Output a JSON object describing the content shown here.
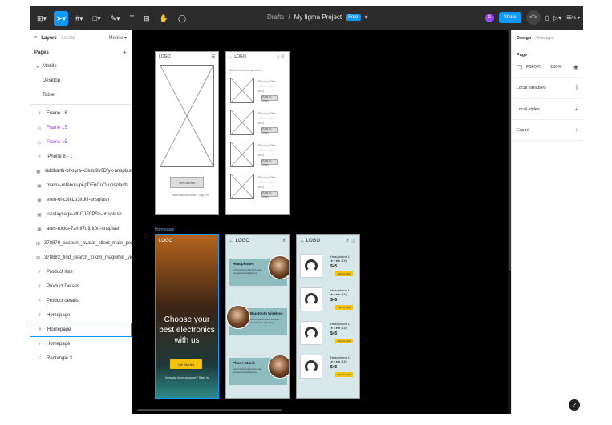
{
  "toolbar": {
    "tools": [
      {
        "icon": "figma-menu-icon",
        "label": "⊞▾",
        "active": false
      },
      {
        "icon": "move-tool-icon",
        "label": "➤▾",
        "active": true
      },
      {
        "icon": "frame-tool-icon",
        "label": "#▾",
        "active": false
      },
      {
        "icon": "shape-tool-icon",
        "label": "□▾",
        "active": false
      },
      {
        "icon": "pen-tool-icon",
        "label": "✎▾",
        "active": false
      },
      {
        "icon": "text-tool-icon",
        "label": "T",
        "active": false
      },
      {
        "icon": "resources-icon",
        "label": "⊞",
        "active": false
      },
      {
        "icon": "hand-tool-icon",
        "label": "✋",
        "active": false
      },
      {
        "icon": "comment-tool-icon",
        "label": "◯",
        "active": false
      }
    ],
    "breadcrumb_drafts": "Drafts",
    "breadcrumb_sep": "/",
    "project_name": "My figma Project",
    "plan_badge": "Free",
    "project_chevron": "▾",
    "avatar_letter": "A",
    "share_label": "Share",
    "dev_label": "</>",
    "library_icon": "▯",
    "present_icon": "▷▾",
    "zoom_label": "55% ▾"
  },
  "left_panel": {
    "tab_layers": "Layers",
    "tab_assets": "Assets",
    "page_dropdown": "Mobile ▾",
    "pages_heading": "Pages",
    "add_page": "+",
    "pages": [
      {
        "label": "Mobile",
        "checked": true
      },
      {
        "label": "Desktop",
        "checked": false
      },
      {
        "label": "Tablet",
        "checked": false
      }
    ],
    "layers": [
      {
        "label": "Frame 18",
        "icon": "#",
        "style": ""
      },
      {
        "label": "Frame 15",
        "icon": "◇",
        "style": "purple"
      },
      {
        "label": "Frame 15",
        "icon": "◇",
        "style": "purple"
      },
      {
        "label": "iPhone 8 - 1",
        "icon": "#",
        "style": ""
      },
      {
        "label": "siddharth-bhogra-k3kdu9k0Dfyk-unsplash 1",
        "icon": "▣",
        "style": ""
      },
      {
        "label": "mama-mfenou-pi-pDEnCoO-unsplash",
        "icon": "▣",
        "style": ""
      },
      {
        "label": "eren-ol-c3IcLo3xdU-unsplash",
        "icon": "▣",
        "style": ""
      },
      {
        "label": "jusstaysage-vlt-OJF0PSh-unsplash",
        "icon": "▣",
        "style": ""
      },
      {
        "label": "ares-rocks-7zmIf7dfgIt0o-unsplash",
        "icon": "▣",
        "style": ""
      },
      {
        "label": "378879_account_avatar_client_male_person_icon",
        "icon": "⊞",
        "style": ""
      },
      {
        "label": "378882_find_search_zoom_magnifier_view_icon",
        "icon": "⊞",
        "style": ""
      },
      {
        "label": "Product lists",
        "icon": "#",
        "style": ""
      },
      {
        "label": "Product Details",
        "icon": "#",
        "style": ""
      },
      {
        "label": "Product details",
        "icon": "#",
        "style": ""
      },
      {
        "label": "Homepage",
        "icon": "#",
        "style": ""
      },
      {
        "label": "Homepage",
        "icon": "#",
        "style": "sel"
      },
      {
        "label": "Homepage",
        "icon": "#",
        "style": ""
      },
      {
        "label": "Rectangle 3",
        "icon": "□",
        "style": ""
      }
    ]
  },
  "canvas": {
    "frame_label": "Homepage",
    "wireframe_home": {
      "logo": "LOGO",
      "menu_icon": "☰",
      "button": "Get Started",
      "link": "Need an account? Sign in"
    },
    "wireframe_list": {
      "back": "← LOGO",
      "icons": "⌕ 🛒",
      "subtitle": "Bluetooth Headphones",
      "items": [
        {
          "name": "Product Title",
          "stars": "☆☆☆☆☆",
          "price": "$45",
          "btn": "Add to Cart"
        },
        {
          "name": "Product Title",
          "stars": "☆☆☆☆☆",
          "price": "$45",
          "btn": "Add to Cart"
        },
        {
          "name": "Product Title",
          "stars": "☆☆☆☆☆",
          "price": "$45",
          "btn": "Add to Cart"
        },
        {
          "name": "Product Title",
          "stars": "☆☆☆☆☆",
          "price": "$45",
          "btn": "Add to Cart"
        }
      ]
    },
    "hero": {
      "logo": "LOGO",
      "title": "Choose your best electronics with us",
      "button": "Get Started",
      "link": "Already have account? Sign in"
    },
    "categories": {
      "back": "← LOGO",
      "search": "⌕",
      "cards": [
        {
          "title": "Headphones",
          "text": "Lorem ipsum dolor sit amet consectetur adipiscing"
        },
        {
          "title": "Bluetooth Wireless",
          "text": "Lorem ipsum dolor sit amet consectetur adipiscing"
        },
        {
          "title": "Phone Stand",
          "text": "Lorem ipsum dolor sit amet consectetur adipiscing"
        }
      ]
    },
    "products": {
      "back": "← LOGO",
      "icons": "⌕ 🛒",
      "items": [
        {
          "name": "Headphone 1",
          "stars": "★★★★ (15)",
          "price": "$45",
          "btn": "Add to Cart"
        },
        {
          "name": "Headphone 1",
          "stars": "★★★★ (15)",
          "price": "$45",
          "btn": "Add to Cart"
        },
        {
          "name": "Headphone 1",
          "stars": "★★★★ (15)",
          "price": "$45",
          "btn": "Add to Cart"
        },
        {
          "name": "Headphone 1",
          "stars": "★★★★ (15)",
          "price": "$45",
          "btn": "Add to Cart"
        }
      ]
    }
  },
  "right_panel": {
    "tab_design": "Design",
    "tab_prototype": "Prototype",
    "page_heading": "Page",
    "bg_color": "F5F5F5",
    "bg_opacity": "100%",
    "eye_icon": "◉",
    "local_variables": "Local variables",
    "local_variables_icon": "⫼",
    "local_styles": "Local styles",
    "export": "Export",
    "plus": "+",
    "help": "?"
  },
  "colors": {
    "accent": "#0d99ff",
    "canvas": "#000000",
    "selection_purple": "#9747ff",
    "yellow": "#f4c20d",
    "teal": "#8fbcbf"
  }
}
